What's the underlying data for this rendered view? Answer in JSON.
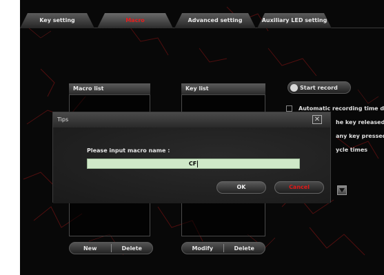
{
  "tabs": [
    {
      "label": "Key setting"
    },
    {
      "label": "Macro"
    },
    {
      "label": "Advanced setting"
    },
    {
      "label": "Auxiliary LED setting"
    }
  ],
  "active_tab": "Macro",
  "macro_list": {
    "header": "Macro list",
    "buttons": {
      "new": "New",
      "delete": "Delete"
    }
  },
  "key_list": {
    "header": "Key list",
    "buttons": {
      "modify": "Modify",
      "delete": "Delete"
    }
  },
  "record": {
    "start_label": "Start record",
    "options": [
      {
        "label": "Automatic recording time de"
      },
      {
        "label": "he key released"
      },
      {
        "label": "any key pressed"
      },
      {
        "label": "ycle times"
      }
    ]
  },
  "dialog": {
    "title": "Tips",
    "close_icon": "close-icon",
    "prompt": "Please input macro name :",
    "input_value": "CF",
    "ok_label": "OK",
    "cancel_label": "Cancel"
  },
  "colors": {
    "accent_red": "#e01818",
    "background": "#080808",
    "input_bg": "#cfe9c8"
  }
}
